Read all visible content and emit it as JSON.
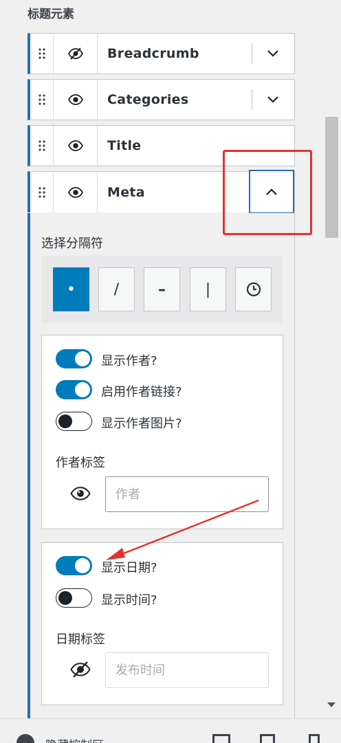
{
  "section_title": "标题元素",
  "items": [
    {
      "label": "Breadcrumb",
      "visible": false
    },
    {
      "label": "Categories",
      "visible": true
    },
    {
      "label": "Title",
      "visible": true
    },
    {
      "label": "Meta",
      "visible": true,
      "expanded": true
    }
  ],
  "separator": {
    "label": "选择分隔符",
    "options": [
      "•",
      "/",
      "–",
      "|",
      "clock-icon"
    ],
    "selected": 0
  },
  "author_panel": {
    "show_author": "显示作者?",
    "author_link": "启用作者链接?",
    "author_image": "显示作者图片?",
    "label_title": "作者标签",
    "label_placeholder": "作者"
  },
  "date_panel": {
    "show_date": "显示日期?",
    "show_time": "显示时间?",
    "label_title": "日期标签",
    "label_placeholder": "发布时间"
  },
  "bottom": {
    "collapse_label": "隐藏控制区"
  },
  "colors": {
    "accent": "#007cba",
    "highlight": "#e5312b"
  }
}
